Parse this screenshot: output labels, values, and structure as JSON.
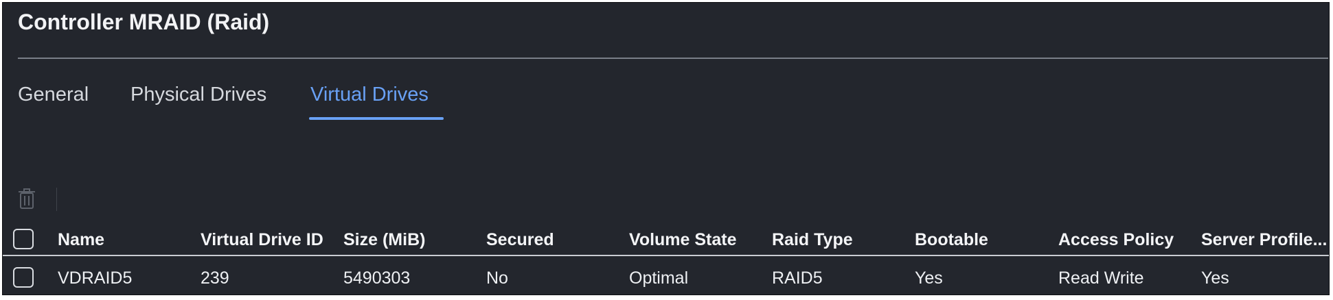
{
  "panel": {
    "title": "Controller MRAID (Raid)"
  },
  "tabs": [
    {
      "label": "General",
      "active": false
    },
    {
      "label": "Physical Drives",
      "active": false
    },
    {
      "label": "Virtual Drives",
      "active": true
    }
  ],
  "toolbar": {
    "delete_icon": "trash-icon"
  },
  "table": {
    "columns": [
      "Name",
      "Virtual Drive ID",
      "Size (MiB)",
      "Secured",
      "Volume State",
      "Raid Type",
      "Bootable",
      "Access Policy",
      "Server Profile..."
    ],
    "rows": [
      [
        "VDRAID5",
        "239",
        "5490303",
        "No",
        "Optimal",
        "RAID5",
        "Yes",
        "Read Write",
        "Yes"
      ]
    ]
  },
  "colors": {
    "background": "#23262d",
    "accent": "#69a1f5",
    "text": "#eef0f3"
  }
}
